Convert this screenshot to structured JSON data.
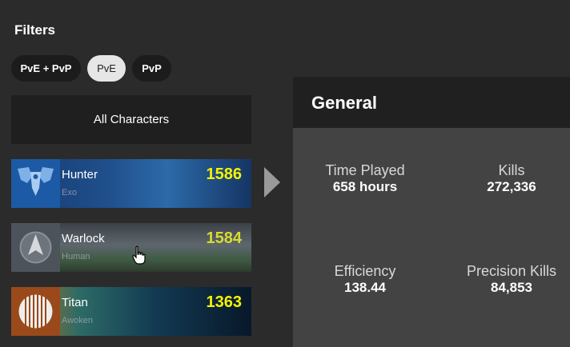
{
  "filters": {
    "title": "Filters",
    "modes": [
      {
        "label": "PvE + PvP",
        "selected": false
      },
      {
        "label": "PvE",
        "selected": true
      },
      {
        "label": "PvP",
        "selected": false
      }
    ]
  },
  "characters": {
    "all_label": "All Characters",
    "list": [
      {
        "class": "Hunter",
        "race": "Exo",
        "power": "1586"
      },
      {
        "class": "Warlock",
        "race": "Human",
        "power": "1584"
      },
      {
        "class": "Titan",
        "race": "Awoken",
        "power": "1363"
      }
    ]
  },
  "panel": {
    "title": "General",
    "stats": [
      {
        "label": "Time Played",
        "value": "658 hours"
      },
      {
        "label": "Kills",
        "value": "272,336"
      },
      {
        "label": "Efficiency",
        "value": "138.44"
      },
      {
        "label": "Precision Kills",
        "value": "84,853"
      }
    ]
  },
  "colors": {
    "power": "#f4f400",
    "selected_pill": "#e6e6e6",
    "panel_bg": "#434343"
  }
}
